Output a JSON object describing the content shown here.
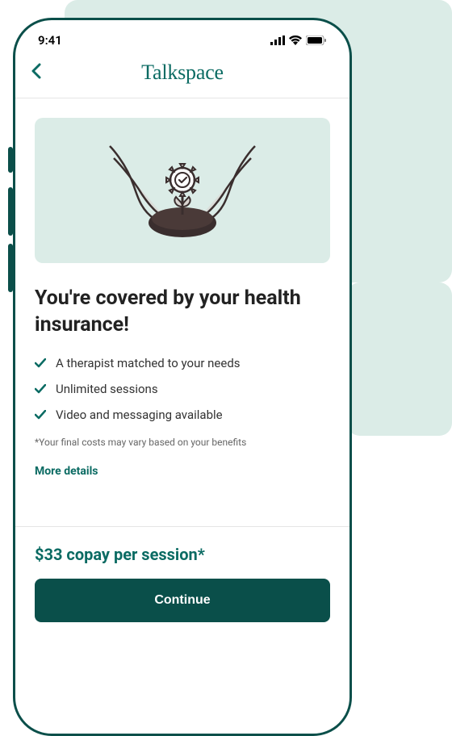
{
  "status_bar": {
    "time": "9:41"
  },
  "header": {
    "brand": "Talkspace"
  },
  "main": {
    "heading": "You're covered by your health insurance!",
    "benefits": [
      "A therapist matched to your needs",
      "Unlimited sessions",
      "Video and messaging available"
    ],
    "fine_print": "*Your final costs may vary based on your benefits",
    "more_details": "More details"
  },
  "footer": {
    "copay": "$33 copay per session*",
    "continue_label": "Continue"
  }
}
